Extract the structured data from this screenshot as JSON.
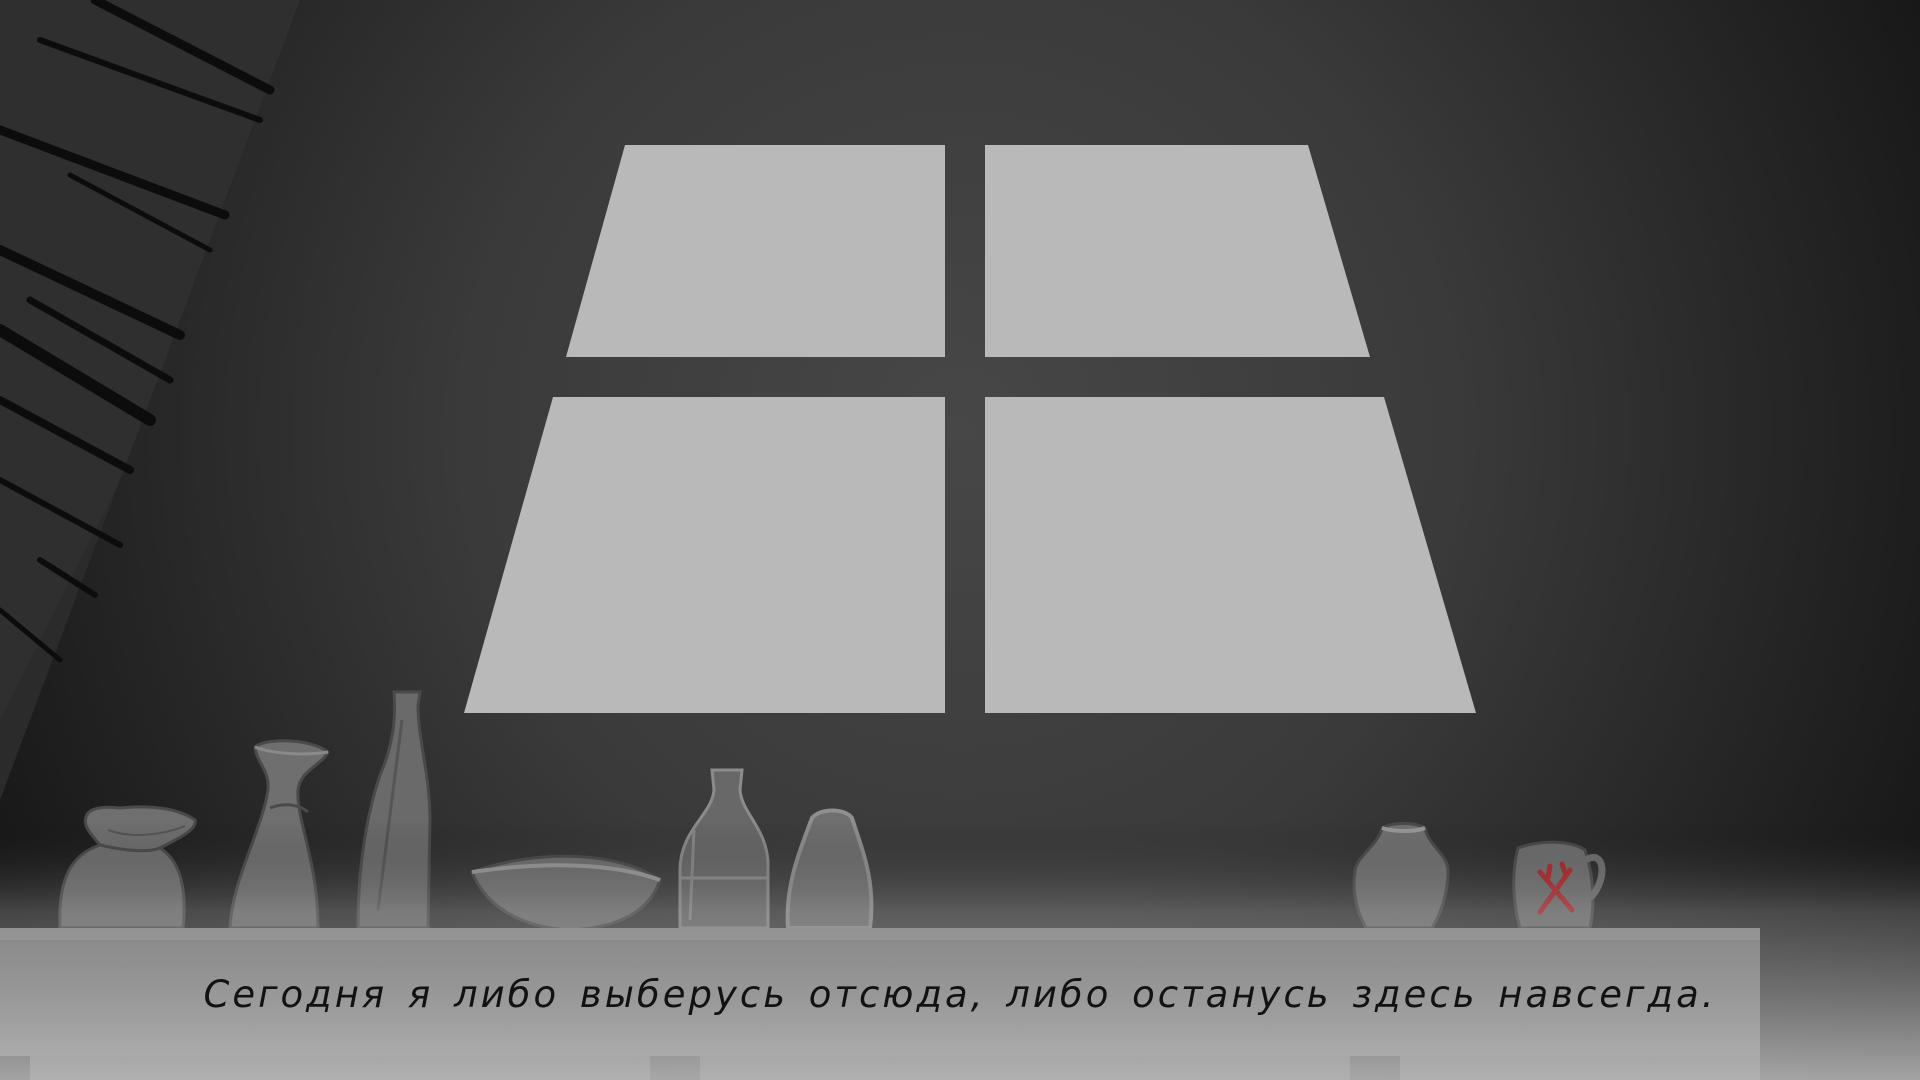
{
  "dialogue": {
    "text": "Сегодня я либо выберусь отсюда, либо останусь здесь навсегда."
  },
  "scene": {
    "window_light_color": "#b9b9b9",
    "wall_color": "#3a3a3a",
    "shelf_color": "#7a7a7a",
    "jar_emblem_color": "#b0262a",
    "objects": [
      "wrapped-jar",
      "vase",
      "tall-bottle",
      "bowl",
      "glass-bottle",
      "small-vase",
      "pot",
      "red-emblem-jug"
    ]
  }
}
